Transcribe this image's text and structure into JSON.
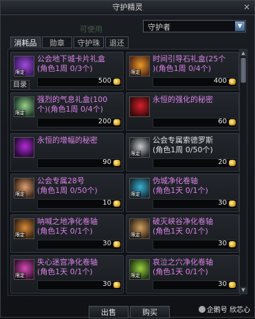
{
  "window": {
    "title": "守护精灵",
    "close": "×"
  },
  "ghost_text": "可使用",
  "dropdown": {
    "value": "守护者",
    "arrow": "▼"
  },
  "tabs": [
    "消耗品",
    "勋章",
    "守护珠",
    "退还"
  ],
  "items": [
    {
      "name": "公会地下城卡片礼盒\n(角色1周 0/3个)",
      "price": "500",
      "limited": true,
      "color": "purple",
      "icon_colors": [
        "#3a1a66",
        "#a24ad8"
      ]
    },
    {
      "name": "时间引导石礼盒(25个\n)(角色1周 0/4个)",
      "price": "400",
      "limited": true,
      "color": "purple",
      "icon_colors": [
        "#5a2b12",
        "#e89a2a"
      ]
    },
    {
      "name": "强烈的气息礼盒(100\n个)(角色1周 0/4个)",
      "price": "200",
      "limited": true,
      "color": "purple",
      "icon_colors": [
        "#1b3a2a",
        "#9ad08a"
      ]
    },
    {
      "name": "永恒的强化的秘密",
      "price": "60",
      "limited": false,
      "color": "purple",
      "icon_colors": [
        "#3a0b0b",
        "#d8202a"
      ]
    },
    {
      "name": "永恒的增幅的秘密",
      "price": "90",
      "limited": false,
      "color": "purple",
      "icon_colors": [
        "#2a0b3a",
        "#b32ad8"
      ]
    },
    {
      "name": "公会专属索德罗斯\n(角色1周 0/50个)",
      "price": "20",
      "limited": true,
      "color": "white",
      "icon_colors": [
        "#202428",
        "#c8c8c8"
      ]
    },
    {
      "name": "公会专属28号\n(角色1周 0/50个)",
      "price": "10",
      "limited": true,
      "color": "purple",
      "icon_colors": [
        "#3a2418",
        "#e0a070"
      ]
    },
    {
      "name": "伪城净化卷轴\n(角色1天 0/1个)",
      "price": "30",
      "limited": true,
      "color": "purple",
      "icon_colors": [
        "#15303a",
        "#3ab0d0"
      ]
    },
    {
      "name": "呐喊之地净化卷轴\n(角色1天 0/1个)",
      "price": "30",
      "limited": true,
      "color": "purple",
      "icon_colors": [
        "#3a2410",
        "#d88a3a"
      ]
    },
    {
      "name": "破灭峡谷净化卷轴\n(角色1天 0/1个)",
      "price": "30",
      "limited": true,
      "color": "purple",
      "icon_colors": [
        "#3a2818",
        "#d0a060"
      ]
    },
    {
      "name": "失心迷宫净化卷轴\n(角色1天 0/1个)",
      "price": "30",
      "limited": true,
      "color": "purple",
      "icon_colors": [
        "#3a1030",
        "#d84ab8"
      ]
    },
    {
      "name": "哀泣之穴净化卷轴\n(角色1天 0/1个)",
      "price": "30",
      "limited": true,
      "color": "purple",
      "icon_colors": [
        "#203a12",
        "#9ad040"
      ]
    }
  ],
  "limited_tag": "限定",
  "mulu": "目录",
  "buttons": {
    "sell": "出售",
    "buy": "购买"
  },
  "watermark": "企鹅号 欣芯心"
}
